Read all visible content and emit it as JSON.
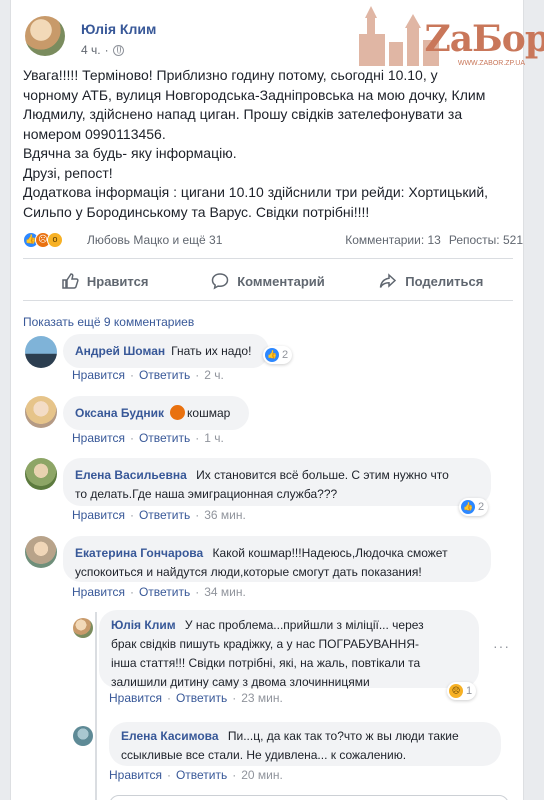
{
  "post": {
    "author": "Юлія Клим",
    "time": "4 ч.",
    "privacy_icon": "globe-icon",
    "text_lines": [
      "Увага!!!!! Терміново! Приблизно годину потому, сьогодні 10.10, у",
      "чорному АТБ, вулиця Новгородська-Задніпровська на мою дочку, Клим",
      "Людмилу, здійснено напад циган. Прошу свідків зателефонувати за",
      "номером 0990113456.",
      "Вдячна за будь- яку інформацію.",
      "Друзі, репост!",
      "Додаткова інформація : цигани 10.10 здійснили три рейди: Хортицький,",
      "Сильпо у Бородинському та Варус. Свідки потрібні!!!!"
    ],
    "reaction_names": "Любовь Мацко и ещё 31",
    "comments_count": "Комментарии: 13",
    "reposts_count": "Репосты: 521"
  },
  "watermark": {
    "text": "ZaБор",
    "url": "WWW.ZABOR.ZP.UA"
  },
  "actions": {
    "like": "Нравится",
    "comment": "Комментарий",
    "share": "Поделиться"
  },
  "show_more": "Показать ещё 9 комментариев",
  "labels": {
    "like": "Нравится",
    "reply": "Ответить",
    "dot": "·"
  },
  "comments": [
    {
      "name": "Андрей Шоман",
      "text": "Гнать их надо!",
      "time": "2 ч.",
      "react_count": "2"
    },
    {
      "name": "Оксана Будник",
      "text": "кошмар",
      "time": "1 ч."
    },
    {
      "name": "Елена Васильевна",
      "text_lines": [
        "Их становится всё больше. С этим нужно что",
        "то делать.Где наша эмиграционная служба???"
      ],
      "time": "36 мин.",
      "react_count": "2"
    },
    {
      "name": "Екатерина Гончарова",
      "text_lines": [
        "Какой кошмар!!!Надеюсь,Людочка сможет",
        "успокоиться и найдутся люди,которые смогут дать показания!"
      ],
      "time": "34 мин."
    }
  ],
  "replies": [
    {
      "name": "Юлія Клим",
      "text_lines": [
        "У нас проблема...прийшли з міліції... через",
        "брак свідків пишуть крадіжку, а у нас ПОГРАБУВАННЯ-",
        "інша стаття!!! Свідки потрібні, які, на жаль, повтікали та",
        "залишили дитину саму з двома злочинницями"
      ],
      "time": "23 мин.",
      "react_count": "1"
    },
    {
      "name": "Елена Касимова",
      "text_lines": [
        "Пи...ц, да как так то?что ж вы люди такие",
        "ссыкливые все стали. Не удивлена... к сожалению."
      ],
      "time": "20 мин."
    }
  ],
  "colors": {
    "link": "#385898",
    "like": "#2d88ff",
    "angry": "#e9710f",
    "wow": "#f7b125"
  }
}
